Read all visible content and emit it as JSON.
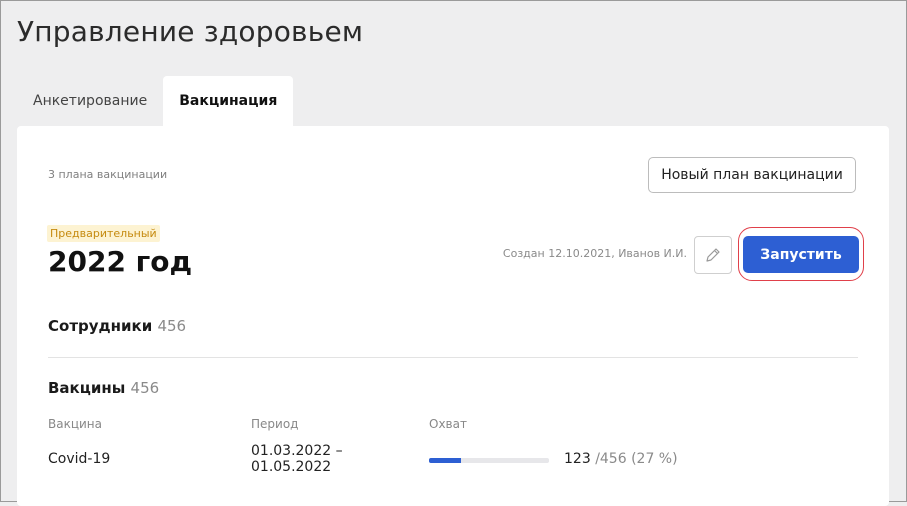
{
  "page": {
    "title": "Управление здоровьем"
  },
  "tabs": [
    {
      "label": "Анкетирование",
      "active": false
    },
    {
      "label": "Вакцинация",
      "active": true
    }
  ],
  "plans": {
    "count_label": "3 плана вакцинации",
    "new_plan_button": "Новый план вакцинации"
  },
  "plan": {
    "status": "Предварительный",
    "title": "2022 год",
    "created_info": "Создан 12.10.2021, Иванов И.И.",
    "edit_icon": "pencil-icon",
    "launch_button": "Запустить",
    "employees": {
      "label": "Сотрудники",
      "count": "456"
    },
    "vaccines": {
      "label": "Вакцины",
      "count": "456",
      "columns": [
        "Вакцина",
        "Период",
        "Охват"
      ],
      "rows": [
        {
          "name": "Covid-19",
          "period_start": "01.03.2022 –",
          "period_end": "01.05.2022",
          "coverage_value": "123",
          "coverage_rest": "/456 (27 %)",
          "coverage_fraction": 0.27
        }
      ]
    }
  },
  "colors": {
    "accent": "#2d5fd3",
    "badge_bg": "#fdf3d2",
    "badge_text": "#c58a0f",
    "highlight": "#e0404a"
  }
}
